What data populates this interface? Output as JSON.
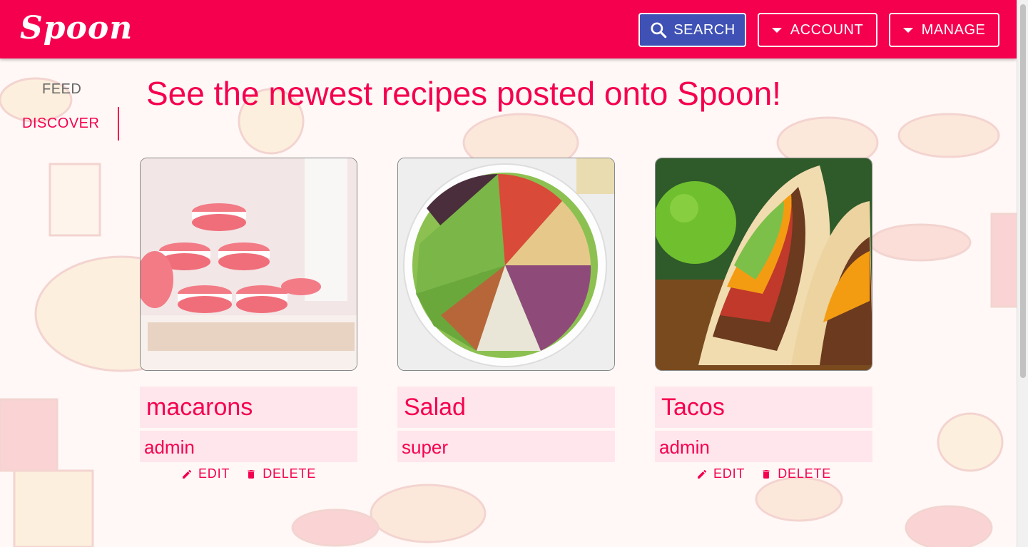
{
  "header": {
    "logo_text": "Spoon",
    "search_label": "SEARCH",
    "account_label": "ACCOUNT",
    "manage_label": "MANAGE"
  },
  "nav": {
    "tabs": [
      {
        "label": "FEED",
        "active": false
      },
      {
        "label": "DISCOVER",
        "active": true
      }
    ]
  },
  "page": {
    "title": "See the newest recipes posted onto Spoon!"
  },
  "recipes": [
    {
      "title": "macarons",
      "author": "admin",
      "edit_label": "EDIT",
      "delete_label": "DELETE",
      "image": "macarons-photo"
    },
    {
      "title": "Salad",
      "author": "super",
      "image": "salad-photo"
    },
    {
      "title": "Tacos",
      "author": "admin",
      "edit_label": "EDIT",
      "delete_label": "DELETE",
      "image": "tacos-photo"
    }
  ],
  "colors": {
    "brand": "#f5004f",
    "search_button": "#3f51b5",
    "card_label_bg": "#ffe6ec"
  },
  "icons": [
    "search-icon",
    "caret-down-icon",
    "pencil-icon",
    "trash-icon"
  ]
}
